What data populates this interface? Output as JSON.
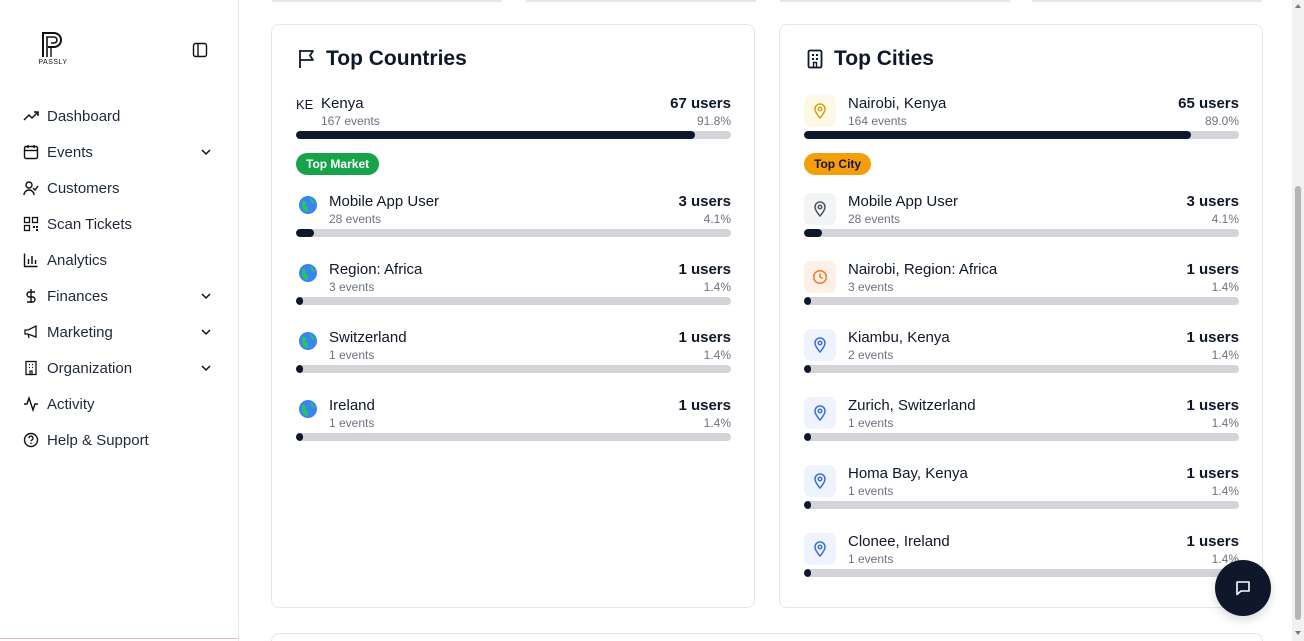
{
  "brand": {
    "name": "PASSLY"
  },
  "sidebar": {
    "items": [
      {
        "label": "Dashboard",
        "icon": "trending-up-icon",
        "has_chevron": false
      },
      {
        "label": "Events",
        "icon": "calendar-icon",
        "has_chevron": true
      },
      {
        "label": "Customers",
        "icon": "user-check-icon",
        "has_chevron": false
      },
      {
        "label": "Scan Tickets",
        "icon": "qr-code-icon",
        "has_chevron": false
      },
      {
        "label": "Analytics",
        "icon": "bar-chart-icon",
        "has_chevron": false
      },
      {
        "label": "Finances",
        "icon": "dollar-icon",
        "has_chevron": true
      },
      {
        "label": "Marketing",
        "icon": "megaphone-icon",
        "has_chevron": true
      },
      {
        "label": "Organization",
        "icon": "building-icon",
        "has_chevron": true
      },
      {
        "label": "Activity",
        "icon": "activity-icon",
        "has_chevron": false
      },
      {
        "label": "Help & Support",
        "icon": "help-circle-icon",
        "has_chevron": false
      }
    ]
  },
  "countries": {
    "title": "Top Countries",
    "badge": "Top Market",
    "rows": [
      {
        "code": "KE",
        "name": "Kenya",
        "events": "167 events",
        "users": "67 users",
        "pct": "91.8%",
        "share": 0.918
      },
      {
        "icon": "globe-icon",
        "name": "Mobile App User",
        "events": "28 events",
        "users": "3 users",
        "pct": "4.1%",
        "share": 0.041
      },
      {
        "icon": "globe-icon",
        "name": "Region: Africa",
        "events": "3 events",
        "users": "1 users",
        "pct": "1.4%",
        "share": 0.014
      },
      {
        "icon": "globe-icon",
        "name": "Switzerland",
        "events": "1 events",
        "users": "1 users",
        "pct": "1.4%",
        "share": 0.014
      },
      {
        "icon": "globe-icon",
        "name": "Ireland",
        "events": "1 events",
        "users": "1 users",
        "pct": "1.4%",
        "share": 0.014
      }
    ]
  },
  "cities": {
    "title": "Top Cities",
    "badge": "Top City",
    "rows": [
      {
        "icon": "map-pin-icon",
        "name": "Nairobi, Kenya",
        "events": "164 events",
        "users": "65 users",
        "pct": "89.0%",
        "share": 0.89,
        "box_color": "#fef9e7",
        "icon_color": "#d4a017"
      },
      {
        "icon": "map-pin-icon",
        "name": "Mobile App User",
        "events": "28 events",
        "users": "3 users",
        "pct": "4.1%",
        "share": 0.041,
        "box_color": "#f3f4f6",
        "icon_color": "#4b5563"
      },
      {
        "icon": "clock-icon",
        "name": "Nairobi, Region: Africa",
        "events": "3 events",
        "users": "1 users",
        "pct": "1.4%",
        "share": 0.014,
        "box_color": "#fdf0e7",
        "icon_color": "#ea7a2c"
      },
      {
        "icon": "map-pin-icon",
        "name": "Kiambu, Kenya",
        "events": "2 events",
        "users": "1 users",
        "pct": "1.4%",
        "share": 0.014,
        "box_color": "#eef3fd",
        "icon_color": "#3b6fd8"
      },
      {
        "icon": "map-pin-icon",
        "name": "Zurich, Switzerland",
        "events": "1 events",
        "users": "1 users",
        "pct": "1.4%",
        "share": 0.014,
        "box_color": "#eef3fd",
        "icon_color": "#3b6fd8"
      },
      {
        "icon": "map-pin-icon",
        "name": "Homa Bay, Kenya",
        "events": "1 events",
        "users": "1 users",
        "pct": "1.4%",
        "share": 0.014,
        "box_color": "#eef3fd",
        "icon_color": "#3b6fd8"
      },
      {
        "icon": "map-pin-icon",
        "name": "Clonee, Ireland",
        "events": "1 events",
        "users": "1 users",
        "pct": "1.4%",
        "share": 0.014,
        "box_color": "#eef3fd",
        "icon_color": "#3b6fd8"
      }
    ]
  },
  "colors": {
    "accent": "#0f172a",
    "top_market": "#16a34a",
    "top_city": "#f59e0b",
    "track": "#d4d4d8"
  },
  "chat": {
    "icon": "message-icon"
  }
}
